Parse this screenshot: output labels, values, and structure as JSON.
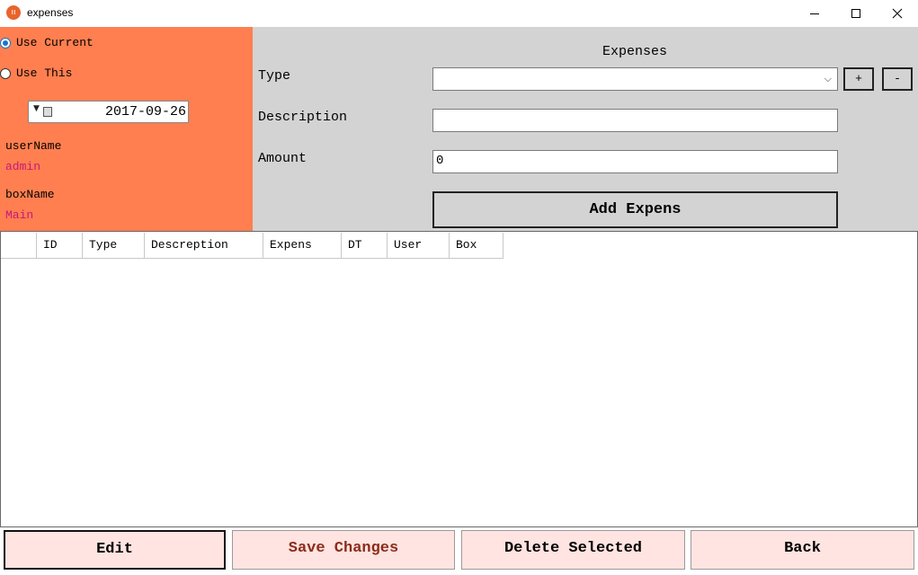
{
  "window": {
    "title": "expenses",
    "app_icon_glyph": "ıı"
  },
  "left": {
    "radio_current": {
      "label": "Use Current",
      "checked": true
    },
    "radio_this": {
      "label": "Use This",
      "checked": false
    },
    "date": {
      "value": "2017-09-26"
    },
    "user_label": "userName",
    "user_value": "admin",
    "box_label": "boxName",
    "box_value": "Main"
  },
  "form": {
    "title": "Expenses",
    "type_label": "Type",
    "type_value": "",
    "description_label": "Description",
    "description_value": "",
    "amount_label": "Amount",
    "amount_value": "0",
    "plus_label": "+",
    "minus_label": "-",
    "add_label": "Add Expens"
  },
  "grid": {
    "columns": [
      "",
      "ID",
      "Type",
      "Descreption",
      "Expens",
      "DT",
      "User",
      "Box"
    ],
    "rows": []
  },
  "actions": {
    "edit": "Edit",
    "save": "Save Changes",
    "delete": "Delete Selected",
    "back": "Back"
  },
  "colors": {
    "left_panel": "#ff7f50",
    "right_panel": "#d3d3d3",
    "value_text": "#c8177a",
    "action_button_bg": "#ffe4e1"
  }
}
